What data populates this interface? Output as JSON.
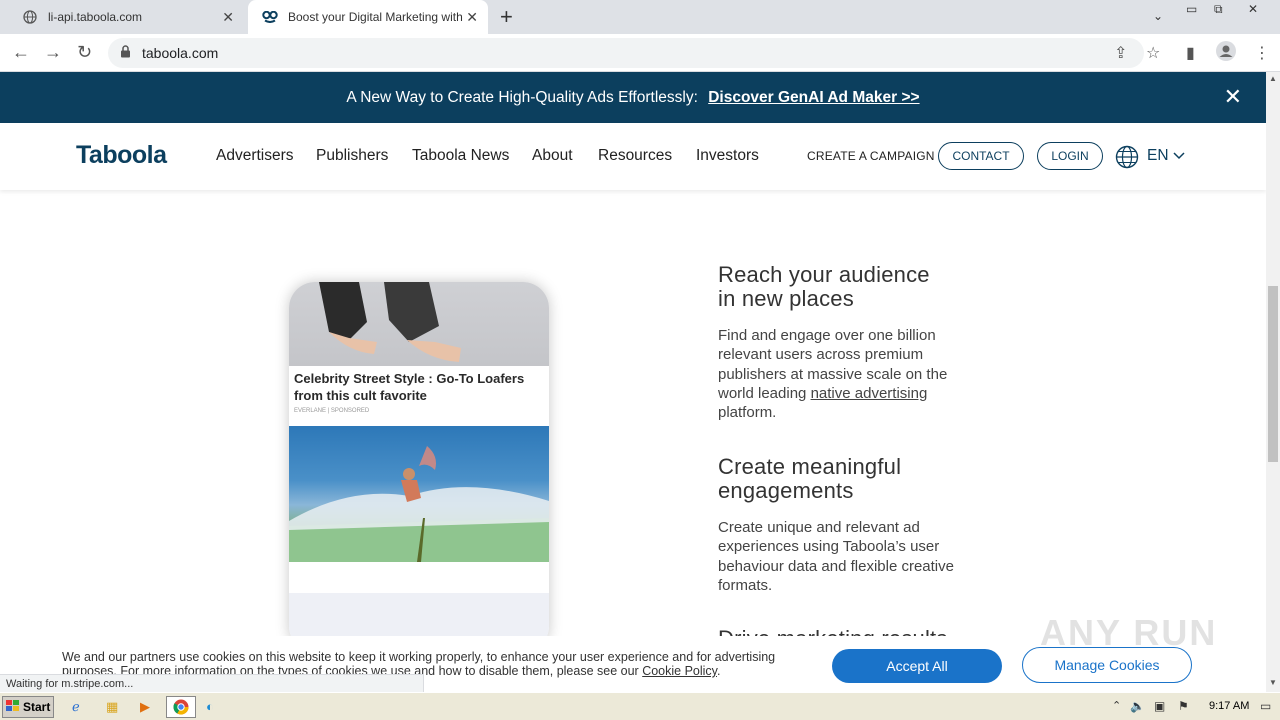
{
  "browser": {
    "tabs": [
      {
        "title": "li-api.taboola.com",
        "icon": "globe-icon"
      },
      {
        "title": "Boost your Digital Marketing with Tab",
        "icon": "taboola-favicon-icon"
      }
    ],
    "url": "taboola.com",
    "status_text": "Waiting for m.stripe.com..."
  },
  "banner": {
    "text": "A New Way to Create High-Quality Ads Effortlessly:",
    "link": "Discover GenAI Ad Maker >>"
  },
  "nav": {
    "logo": "Taboola",
    "links": [
      "Advertisers",
      "Publishers",
      "Taboola News",
      "About",
      "Resources",
      "Investors"
    ],
    "create_campaign": "CREATE A CAMPAIGN",
    "contact": "CONTACT",
    "login": "LOGIN",
    "language": "EN"
  },
  "phone": {
    "headline": "Celebrity Street Style : Go-To Loafers from this cult favorite",
    "source": "EVERLANE | SPONSORED"
  },
  "sections": [
    {
      "title_line1": "Reach your audience",
      "title_line2": "in new places",
      "body_before": "Find and engage over one billion relevant users across premium publishers at massive scale on the world leading",
      "body_link": "native advertising",
      "body_after": "platform."
    },
    {
      "title_line1": "Create meaningful",
      "title_line2": "engagements",
      "body": "Create unique and relevant ad experiences using Taboola’s user behaviour data and flexible creative formats."
    },
    {
      "title_line1": "Drive marketing results"
    }
  ],
  "cookie": {
    "text": "We and our partners use cookies on this website to keep it working properly, to enhance your user experience and for advertising purposes. For more information on the types of cookies we use and how to disable them, please see our",
    "policy_link": "Cookie Policy",
    "accept": "Accept All",
    "manage": "Manage Cookies"
  },
  "taskbar": {
    "start": "Start",
    "clock": "9:17 AM"
  },
  "watermark": "ANY RUN"
}
